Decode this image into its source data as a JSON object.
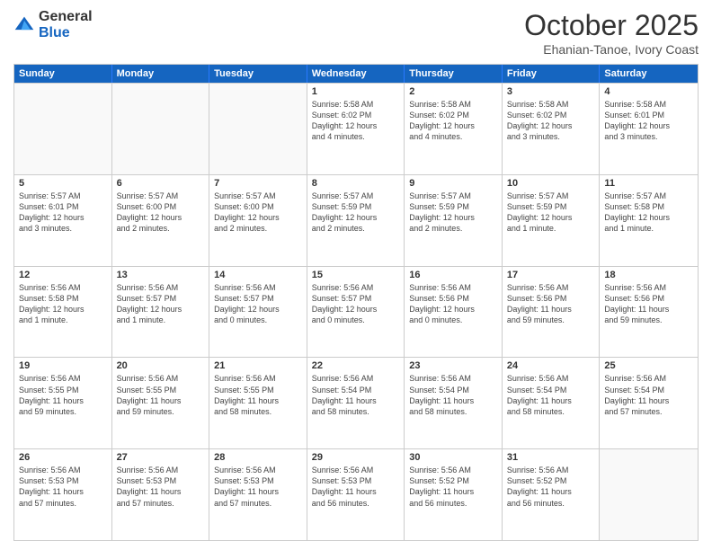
{
  "header": {
    "logo_general": "General",
    "logo_blue": "Blue",
    "month_title": "October 2025",
    "subtitle": "Ehanian-Tanoe, Ivory Coast"
  },
  "day_headers": [
    "Sunday",
    "Monday",
    "Tuesday",
    "Wednesday",
    "Thursday",
    "Friday",
    "Saturday"
  ],
  "weeks": [
    [
      {
        "num": "",
        "info": ""
      },
      {
        "num": "",
        "info": ""
      },
      {
        "num": "",
        "info": ""
      },
      {
        "num": "1",
        "info": "Sunrise: 5:58 AM\nSunset: 6:02 PM\nDaylight: 12 hours\nand 4 minutes."
      },
      {
        "num": "2",
        "info": "Sunrise: 5:58 AM\nSunset: 6:02 PM\nDaylight: 12 hours\nand 4 minutes."
      },
      {
        "num": "3",
        "info": "Sunrise: 5:58 AM\nSunset: 6:02 PM\nDaylight: 12 hours\nand 3 minutes."
      },
      {
        "num": "4",
        "info": "Sunrise: 5:58 AM\nSunset: 6:01 PM\nDaylight: 12 hours\nand 3 minutes."
      }
    ],
    [
      {
        "num": "5",
        "info": "Sunrise: 5:57 AM\nSunset: 6:01 PM\nDaylight: 12 hours\nand 3 minutes."
      },
      {
        "num": "6",
        "info": "Sunrise: 5:57 AM\nSunset: 6:00 PM\nDaylight: 12 hours\nand 2 minutes."
      },
      {
        "num": "7",
        "info": "Sunrise: 5:57 AM\nSunset: 6:00 PM\nDaylight: 12 hours\nand 2 minutes."
      },
      {
        "num": "8",
        "info": "Sunrise: 5:57 AM\nSunset: 5:59 PM\nDaylight: 12 hours\nand 2 minutes."
      },
      {
        "num": "9",
        "info": "Sunrise: 5:57 AM\nSunset: 5:59 PM\nDaylight: 12 hours\nand 2 minutes."
      },
      {
        "num": "10",
        "info": "Sunrise: 5:57 AM\nSunset: 5:59 PM\nDaylight: 12 hours\nand 1 minute."
      },
      {
        "num": "11",
        "info": "Sunrise: 5:57 AM\nSunset: 5:58 PM\nDaylight: 12 hours\nand 1 minute."
      }
    ],
    [
      {
        "num": "12",
        "info": "Sunrise: 5:56 AM\nSunset: 5:58 PM\nDaylight: 12 hours\nand 1 minute."
      },
      {
        "num": "13",
        "info": "Sunrise: 5:56 AM\nSunset: 5:57 PM\nDaylight: 12 hours\nand 1 minute."
      },
      {
        "num": "14",
        "info": "Sunrise: 5:56 AM\nSunset: 5:57 PM\nDaylight: 12 hours\nand 0 minutes."
      },
      {
        "num": "15",
        "info": "Sunrise: 5:56 AM\nSunset: 5:57 PM\nDaylight: 12 hours\nand 0 minutes."
      },
      {
        "num": "16",
        "info": "Sunrise: 5:56 AM\nSunset: 5:56 PM\nDaylight: 12 hours\nand 0 minutes."
      },
      {
        "num": "17",
        "info": "Sunrise: 5:56 AM\nSunset: 5:56 PM\nDaylight: 11 hours\nand 59 minutes."
      },
      {
        "num": "18",
        "info": "Sunrise: 5:56 AM\nSunset: 5:56 PM\nDaylight: 11 hours\nand 59 minutes."
      }
    ],
    [
      {
        "num": "19",
        "info": "Sunrise: 5:56 AM\nSunset: 5:55 PM\nDaylight: 11 hours\nand 59 minutes."
      },
      {
        "num": "20",
        "info": "Sunrise: 5:56 AM\nSunset: 5:55 PM\nDaylight: 11 hours\nand 59 minutes."
      },
      {
        "num": "21",
        "info": "Sunrise: 5:56 AM\nSunset: 5:55 PM\nDaylight: 11 hours\nand 58 minutes."
      },
      {
        "num": "22",
        "info": "Sunrise: 5:56 AM\nSunset: 5:54 PM\nDaylight: 11 hours\nand 58 minutes."
      },
      {
        "num": "23",
        "info": "Sunrise: 5:56 AM\nSunset: 5:54 PM\nDaylight: 11 hours\nand 58 minutes."
      },
      {
        "num": "24",
        "info": "Sunrise: 5:56 AM\nSunset: 5:54 PM\nDaylight: 11 hours\nand 58 minutes."
      },
      {
        "num": "25",
        "info": "Sunrise: 5:56 AM\nSunset: 5:54 PM\nDaylight: 11 hours\nand 57 minutes."
      }
    ],
    [
      {
        "num": "26",
        "info": "Sunrise: 5:56 AM\nSunset: 5:53 PM\nDaylight: 11 hours\nand 57 minutes."
      },
      {
        "num": "27",
        "info": "Sunrise: 5:56 AM\nSunset: 5:53 PM\nDaylight: 11 hours\nand 57 minutes."
      },
      {
        "num": "28",
        "info": "Sunrise: 5:56 AM\nSunset: 5:53 PM\nDaylight: 11 hours\nand 57 minutes."
      },
      {
        "num": "29",
        "info": "Sunrise: 5:56 AM\nSunset: 5:53 PM\nDaylight: 11 hours\nand 56 minutes."
      },
      {
        "num": "30",
        "info": "Sunrise: 5:56 AM\nSunset: 5:52 PM\nDaylight: 11 hours\nand 56 minutes."
      },
      {
        "num": "31",
        "info": "Sunrise: 5:56 AM\nSunset: 5:52 PM\nDaylight: 11 hours\nand 56 minutes."
      },
      {
        "num": "",
        "info": ""
      }
    ]
  ]
}
